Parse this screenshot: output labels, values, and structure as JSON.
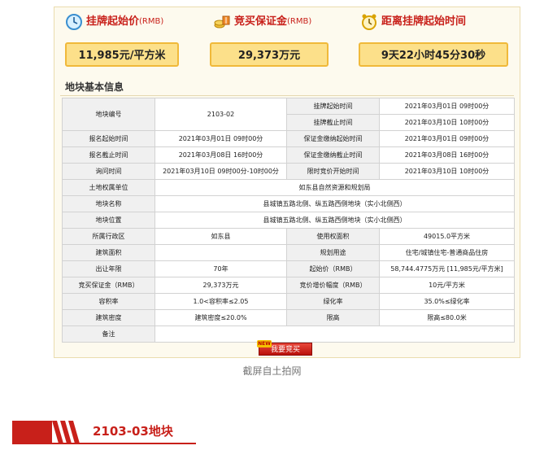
{
  "stats": {
    "start_price": {
      "label": "挂牌起始价",
      "unit": "(RMB)",
      "value": "11,985元/平方米",
      "icon": "clock-icon"
    },
    "deposit": {
      "label": "竞买保证金",
      "unit": "(RMB)",
      "value": "29,373万元",
      "icon": "coins-icon"
    },
    "countdown": {
      "label": "距离挂牌起始时间",
      "value": "9天22小时45分30秒",
      "icon": "alarm-clock-icon"
    }
  },
  "section_title": "地块基本信息",
  "table": {
    "r1": {
      "l1": "地块编号",
      "v1": "2103-02",
      "l2": "挂牌起始时间",
      "v2": "2021年03月01日 09时00分"
    },
    "r2": {
      "l2": "挂牌截止时间",
      "v2": "2021年03月10日 10时00分"
    },
    "r3": {
      "l1": "报名起始时间",
      "v1": "2021年03月01日 09时00分",
      "l2": "保证金缴纳起始时间",
      "v2": "2021年03月01日 09时00分"
    },
    "r4": {
      "l1": "报名截止时间",
      "v1": "2021年03月08日 16时00分",
      "l2": "保证金缴纳截止时间",
      "v2": "2021年03月08日 16时00分"
    },
    "r5": {
      "l1": "询问时间",
      "v1": "2021年03月10日 09时00分-10时00分",
      "l2": "限时竞价开始时间",
      "v2": "2021年03月10日 10时00分"
    },
    "r6": {
      "l1": "土地权属单位",
      "v1": "如东县自然资源和规划局"
    },
    "r7": {
      "l1": "地块名称",
      "v1": "县城镇五路北侧、纵五路西侧地块（实小北侧西）"
    },
    "r8": {
      "l1": "地块位置",
      "v1": "县城镇五路北侧、纵五路西侧地块（实小北侧西）"
    },
    "r9": {
      "l1": "所属行政区",
      "v1": "如东县",
      "l2": "使用权面积",
      "v2": "49015.0平方米"
    },
    "r10": {
      "l1": "建筑面积",
      "v1": "",
      "l2": "规划用途",
      "v2": "住宅/城镇住宅-普通商品住房"
    },
    "r11": {
      "l1": "出让年限",
      "v1": "70年",
      "l2": "起始价（RMB）",
      "v2": "58,744.4775万元 [11,985元/平方米]"
    },
    "r12": {
      "l1": "竞买保证金（RMB）",
      "v1": "29,373万元",
      "l2": "竞价增价幅度（RMB）",
      "v2": "10元/平方米"
    },
    "r13": {
      "l1": "容积率",
      "v1": "1.0<容积率≤2.05",
      "l2": "绿化率",
      "v2": "35.0%≤绿化率"
    },
    "r14": {
      "l1": "建筑密度",
      "v1": "建筑密度≤20.0%",
      "l2": "限高",
      "v2": "限高≤80.0米"
    },
    "r15": {
      "l1": "备注",
      "v1": ""
    }
  },
  "buy_button": {
    "label": "我要竞买",
    "tag": "NEW"
  },
  "caption": "截屏自土拍网",
  "bottom_heading": "2103-03地块",
  "colors": {
    "brand_red": "#c8201a",
    "highlight_box": "#fce08a",
    "highlight_border": "#f0b93a"
  }
}
